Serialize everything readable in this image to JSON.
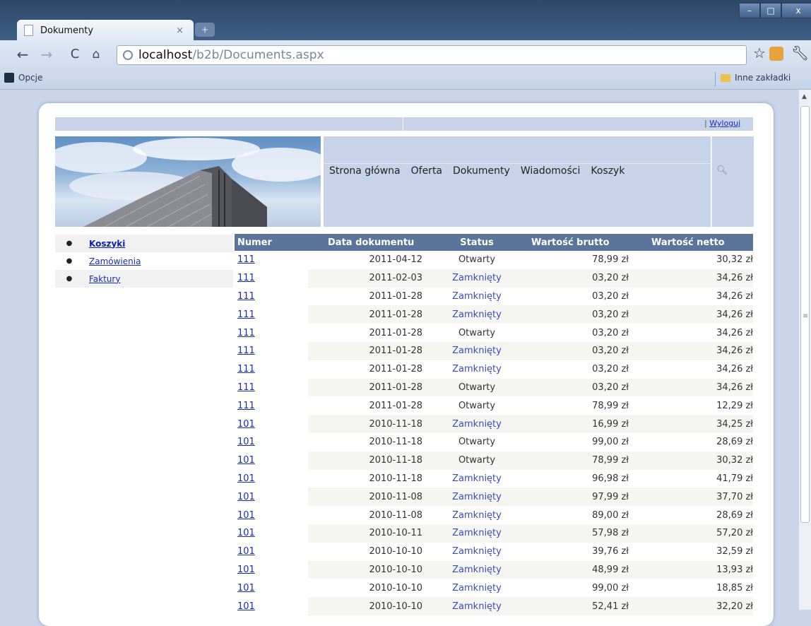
{
  "browser": {
    "tab_title": "Dokumenty",
    "tab_close": "×",
    "new_tab": "+",
    "window_controls": [
      "–",
      "□",
      "x"
    ],
    "url_host": "localhost",
    "url_path": "/b2b/Documents.aspx",
    "bookmark_left": "Opcje",
    "bookmark_right": "Inne zakładki",
    "icons": [
      "back-icon",
      "forward-icon",
      "reload-icon",
      "home-icon",
      "globe-icon",
      "star-icon",
      "extension-icon",
      "wrench-icon",
      "folder-icon"
    ]
  },
  "header": {
    "separator": "|",
    "logout": "Wyloguj"
  },
  "nav": {
    "items": [
      "Strona główna",
      "Oferta",
      "Dokumenty",
      "Wiadomości",
      "Koszyk"
    ]
  },
  "sidebar": {
    "items": [
      {
        "label": "Koszyki",
        "active": true
      },
      {
        "label": "Zamówienia",
        "active": false
      },
      {
        "label": "Faktury",
        "active": false
      }
    ]
  },
  "table": {
    "headers": [
      "Numer",
      "Data dokumentu",
      "Status",
      "Wartość brutto",
      "Wartość netto"
    ],
    "rows": [
      {
        "num": "111",
        "date": "2011-04-12",
        "status": "Otwarty",
        "brutto": "78,99 zł",
        "netto": "30,32 zł"
      },
      {
        "num": "111",
        "date": "2011-02-03",
        "status": "Zamknięty",
        "brutto": "03,20 zł",
        "netto": "34,26 zł"
      },
      {
        "num": "111",
        "date": "2011-01-28",
        "status": "Zamknięty",
        "brutto": "03,20 zł",
        "netto": "34,26 zł"
      },
      {
        "num": "111",
        "date": "2011-01-28",
        "status": "Zamknięty",
        "brutto": "03,20 zł",
        "netto": "34,26 zł"
      },
      {
        "num": "111",
        "date": "2011-01-28",
        "status": "Otwarty",
        "brutto": "03,20 zł",
        "netto": "34,26 zł"
      },
      {
        "num": "111",
        "date": "2011-01-28",
        "status": "Zamknięty",
        "brutto": "03,20 zł",
        "netto": "34,26 zł"
      },
      {
        "num": "111",
        "date": "2011-01-28",
        "status": "Zamknięty",
        "brutto": "03,20 zł",
        "netto": "34,26 zł"
      },
      {
        "num": "111",
        "date": "2011-01-28",
        "status": "Otwarty",
        "brutto": "03,20 zł",
        "netto": "34,26 zł"
      },
      {
        "num": "111",
        "date": "2011-01-28",
        "status": "Otwarty",
        "brutto": "78,99 zł",
        "netto": "12,29 zł"
      },
      {
        "num": "101",
        "date": "2010-11-18",
        "status": "Zamknięty",
        "brutto": "16,99 zł",
        "netto": "34,25 zł"
      },
      {
        "num": "101",
        "date": "2010-11-18",
        "status": "Otwarty",
        "brutto": "99,00 zł",
        "netto": "28,69 zł"
      },
      {
        "num": "101",
        "date": "2010-11-18",
        "status": "Otwarty",
        "brutto": "78,99 zł",
        "netto": "30,32 zł"
      },
      {
        "num": "101",
        "date": "2010-11-18",
        "status": "Zamknięty",
        "brutto": "96,98 zł",
        "netto": "41,79 zł"
      },
      {
        "num": "101",
        "date": "2010-11-08",
        "status": "Zamknięty",
        "brutto": "97,99 zł",
        "netto": "37,70 zł"
      },
      {
        "num": "101",
        "date": "2010-11-08",
        "status": "Zamknięty",
        "brutto": "89,00 zł",
        "netto": "28,69 zł"
      },
      {
        "num": "101",
        "date": "2010-10-11",
        "status": "Zamknięty",
        "brutto": "57,98 zł",
        "netto": "57,20 zł"
      },
      {
        "num": "101",
        "date": "2010-10-10",
        "status": "Zamknięty",
        "brutto": "39,76 zł",
        "netto": "32,59 zł"
      },
      {
        "num": "101",
        "date": "2010-10-10",
        "status": "Zamknięty",
        "brutto": "48,99 zł",
        "netto": "13,93 zł"
      },
      {
        "num": "101",
        "date": "2010-10-10",
        "status": "Zamknięty",
        "brutto": "99,00 zł",
        "netto": "18,85 zł"
      },
      {
        "num": "101",
        "date": "2010-10-10",
        "status": "Zamknięty",
        "brutto": "52,41 zł",
        "netto": "32,20 zł"
      }
    ]
  },
  "colors": {
    "page_bg": "#c9d6ea",
    "panel": "#c6d3e8",
    "table_header": "#5a7599",
    "link": "#1a2db8"
  }
}
